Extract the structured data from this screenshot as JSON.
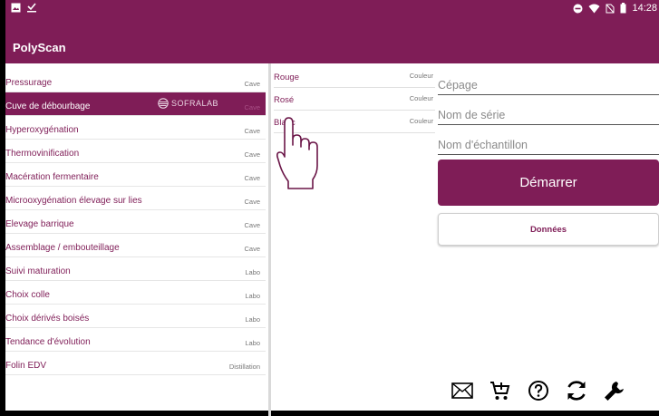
{
  "status_bar": {
    "time": "14:28",
    "icons": [
      "image-icon",
      "check-download-icon",
      "do-not-disturb-icon",
      "wifi-icon",
      "no-sim-icon",
      "battery-icon"
    ]
  },
  "app": {
    "title": "PolyScan"
  },
  "left_list": [
    {
      "name": "Pressurage",
      "tag": "Cave"
    },
    {
      "name": "Cuve de débourbage",
      "tag": "Cave",
      "selected": true,
      "brand": "SOFRALAB"
    },
    {
      "name": "Hyperoxygénation",
      "tag": "Cave"
    },
    {
      "name": "Thermovinification",
      "tag": "Cave"
    },
    {
      "name": "Macération fermentaire",
      "tag": "Cave"
    },
    {
      "name": "Microoxygénation élevage sur lies",
      "tag": "Cave"
    },
    {
      "name": "Elevage barrique",
      "tag": "Cave"
    },
    {
      "name": "Assemblage / embouteillage",
      "tag": "Cave"
    },
    {
      "name": "Suivi maturation",
      "tag": "Labo"
    },
    {
      "name": "Choix colle",
      "tag": "Labo"
    },
    {
      "name": "Choix dérivés boisés",
      "tag": "Labo"
    },
    {
      "name": "Tendance d'évolution",
      "tag": "Labo"
    },
    {
      "name": "Folin EDV",
      "tag": "Distillation"
    }
  ],
  "middle_list": [
    {
      "name": "Rouge",
      "tag": "Couleur"
    },
    {
      "name": "Rosé",
      "tag": "Couleur"
    },
    {
      "name": "Blanc",
      "tag": "Couleur"
    }
  ],
  "form": {
    "cepage_placeholder": "Cépage",
    "serie_placeholder": "Nom de série",
    "echantillon_placeholder": "Nom d'échantillon",
    "start_label": "Démarrer",
    "data_label": "Données"
  },
  "toolbar": [
    "mail-icon",
    "add-to-cart-icon",
    "help-icon",
    "sync-icon",
    "wrench-icon"
  ],
  "colors": {
    "primary": "#7f1d57",
    "divider": "#d9d9d9"
  }
}
